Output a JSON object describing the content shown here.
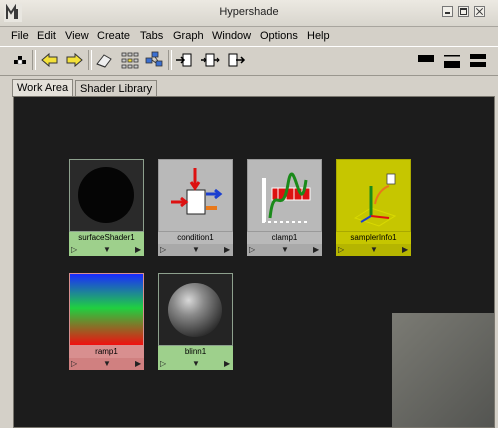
{
  "window": {
    "title": "Hypershade"
  },
  "menu": [
    "File",
    "Edit",
    "View",
    "Create",
    "Tabs",
    "Graph",
    "Window",
    "Options",
    "Help"
  ],
  "tabs": [
    {
      "label": "Work Area",
      "active": true
    },
    {
      "label": "Shader Library",
      "active": false
    }
  ],
  "nodes": [
    {
      "name": "surfaceShader1",
      "label_color": "#9ed08c",
      "preview": "black-sphere"
    },
    {
      "name": "condition1",
      "label_color": "#b9b9b9",
      "preview": "condition-icon"
    },
    {
      "name": "clamp1",
      "label_color": "#b9b9b9",
      "preview": "clamp-icon"
    },
    {
      "name": "samplerInfo1",
      "label_color": "#c6c600",
      "preview": "sampler-icon"
    },
    {
      "name": "ramp1",
      "label_color": "#d88f8f",
      "preview": "ramp-gradient"
    },
    {
      "name": "blinn1",
      "label_color": "#9ed08c",
      "preview": "gray-sphere"
    }
  ],
  "port_glyphs": {
    "left": "▷",
    "middle": "▼",
    "right": "▶"
  },
  "icons": [
    "maya-logo-icon",
    "minimize-icon",
    "maximize-icon",
    "close-icon"
  ]
}
